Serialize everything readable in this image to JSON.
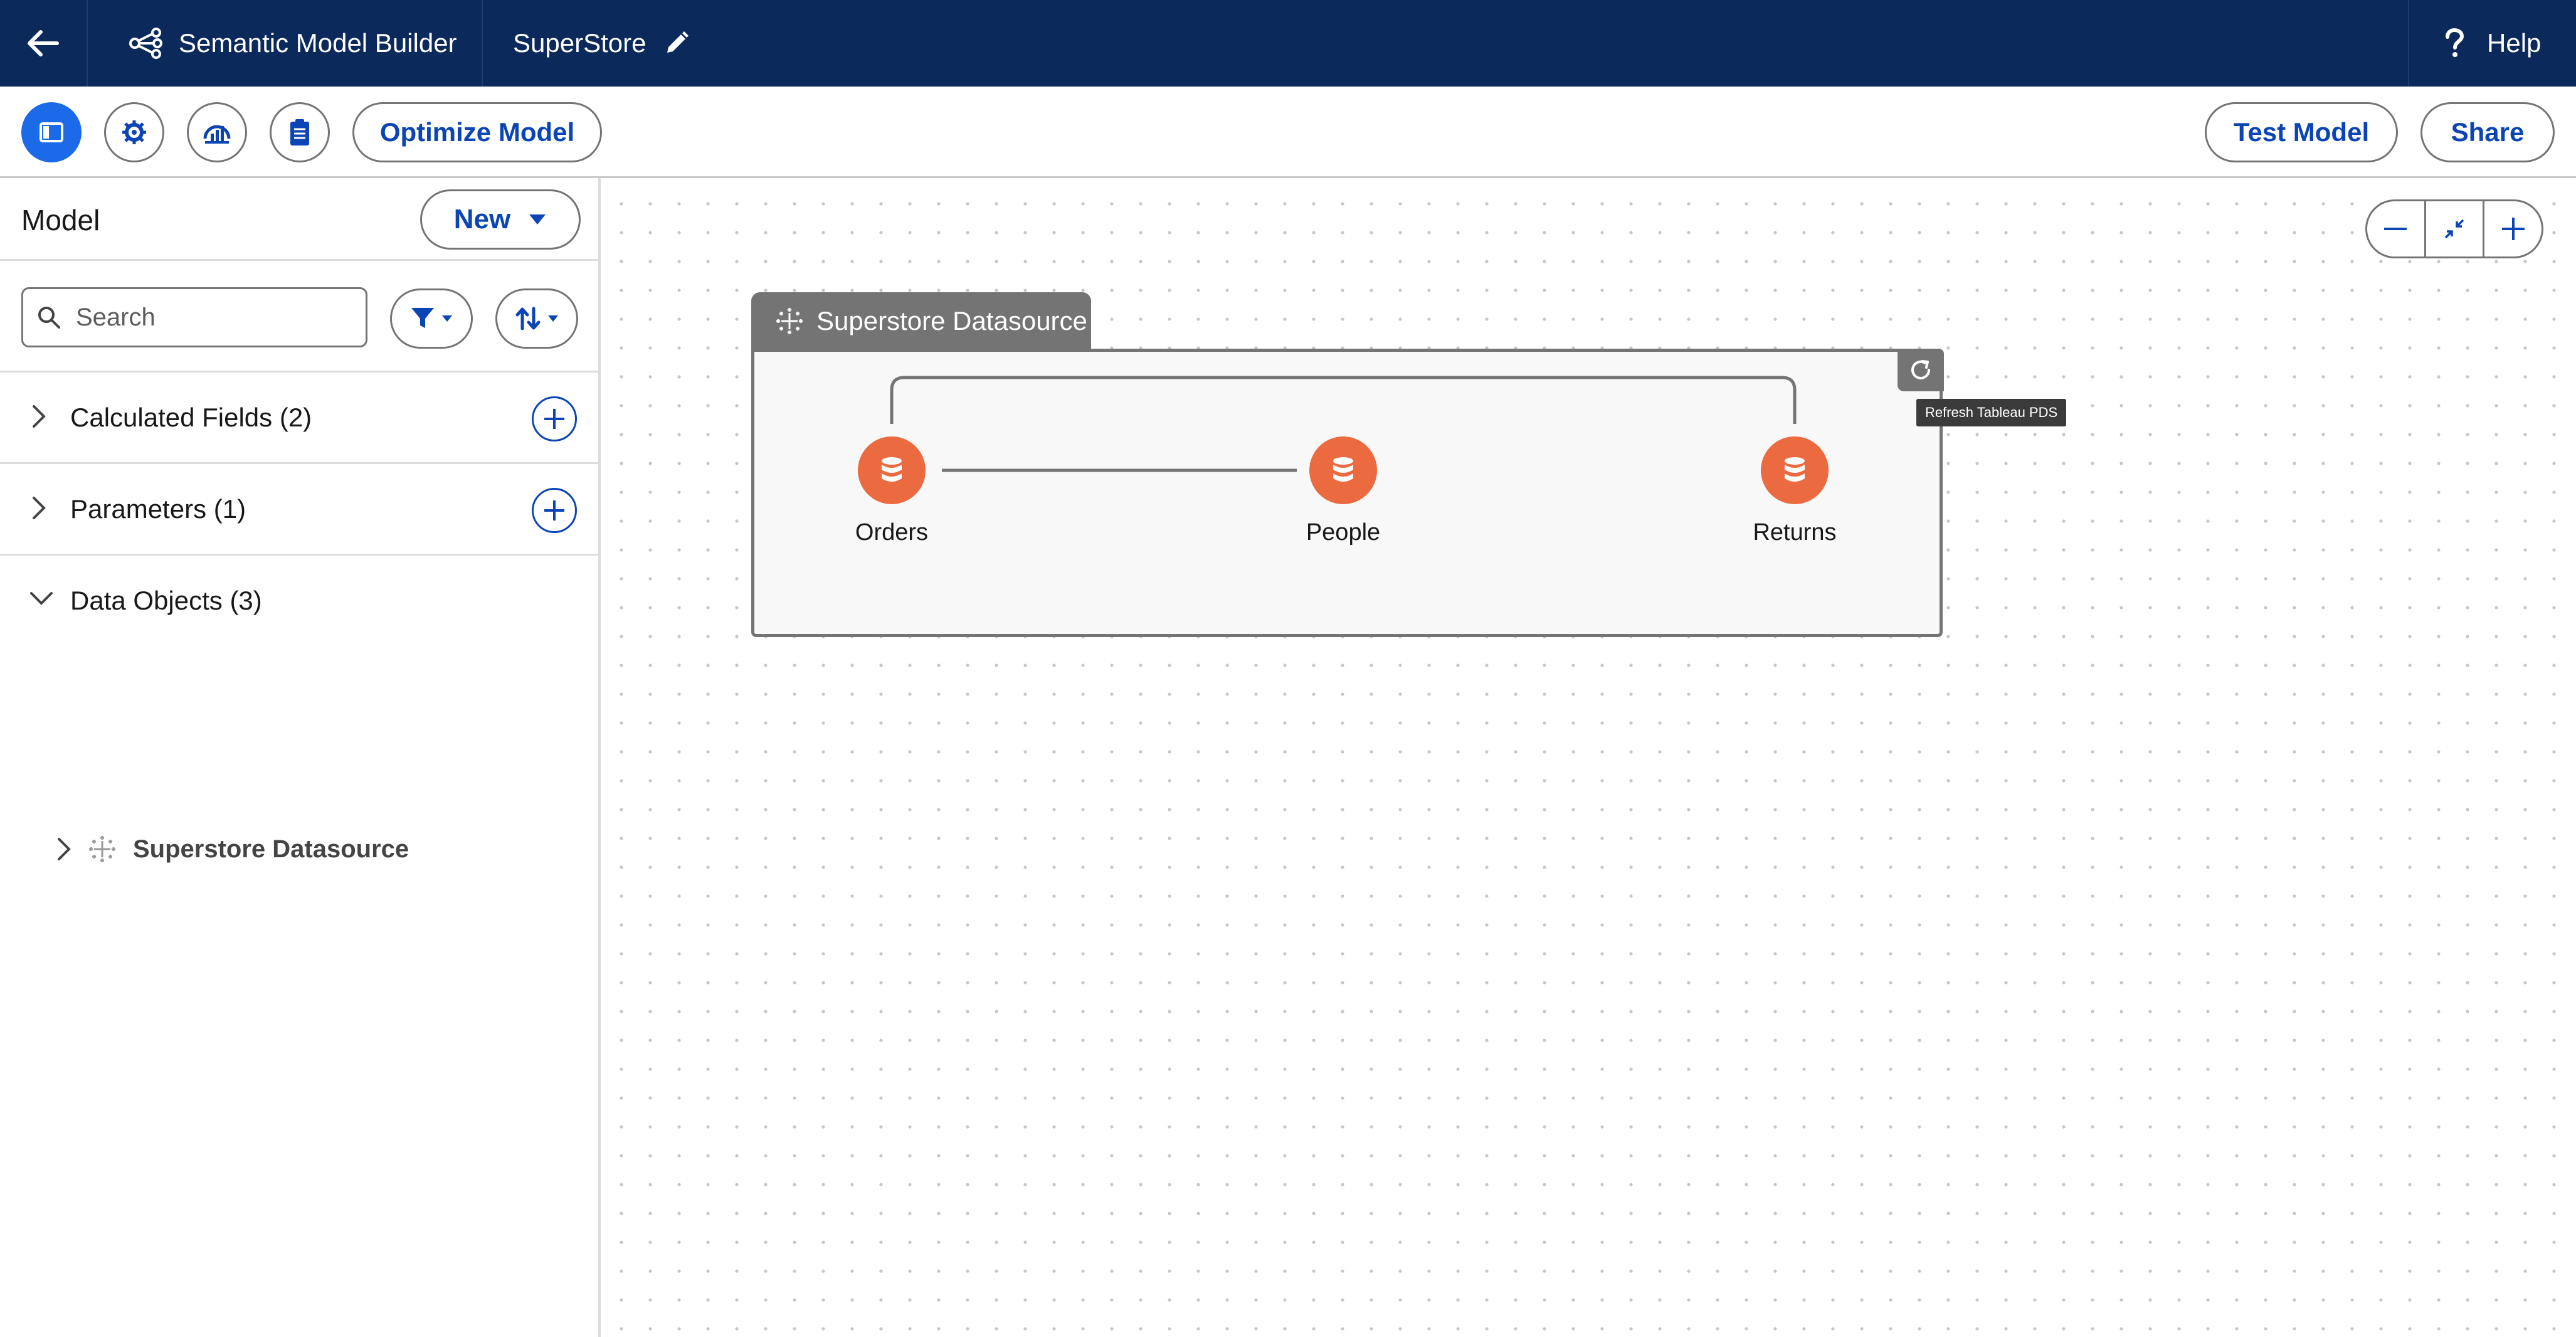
{
  "header": {
    "app_title": "Semantic Model Builder",
    "model_name": "SuperStore",
    "help_label": "Help"
  },
  "toolbar": {
    "optimize_label": "Optimize Model",
    "test_label": "Test Model",
    "share_label": "Share"
  },
  "panel": {
    "title": "Model",
    "new_label": "New",
    "search_placeholder": "Search",
    "sections": [
      {
        "label": "Calculated Fields (2)",
        "expanded": false
      },
      {
        "label": "Parameters (1)",
        "expanded": false
      },
      {
        "label": "Data Objects (3)",
        "expanded": true
      }
    ],
    "tree_item": "Superstore Datasource"
  },
  "canvas": {
    "datasource_title": "Superstore Datasource",
    "refresh_tooltip": "Refresh Tableau PDS",
    "nodes": [
      {
        "label": "Orders"
      },
      {
        "label": "People"
      },
      {
        "label": "Returns"
      }
    ]
  },
  "colors": {
    "header_bg": "#0b2a5b",
    "brand_blue": "#0b45b5",
    "active_blue": "#1b6ae8",
    "node_orange": "#ec6a3f",
    "datasource_gray": "#747474"
  },
  "icons": {
    "back": "arrow-left-icon",
    "app": "model-graph-icon",
    "edit": "pencil-icon",
    "help": "question-icon",
    "toolbar": [
      "panel-toggle-icon",
      "settings-icon",
      "insights-icon",
      "clipboard-icon"
    ],
    "search": "search-icon",
    "filter": "filter-icon",
    "sort": "sort-icon",
    "datasource": "tableau-logo-icon",
    "node": "database-icon",
    "refresh": "refresh-icon"
  }
}
